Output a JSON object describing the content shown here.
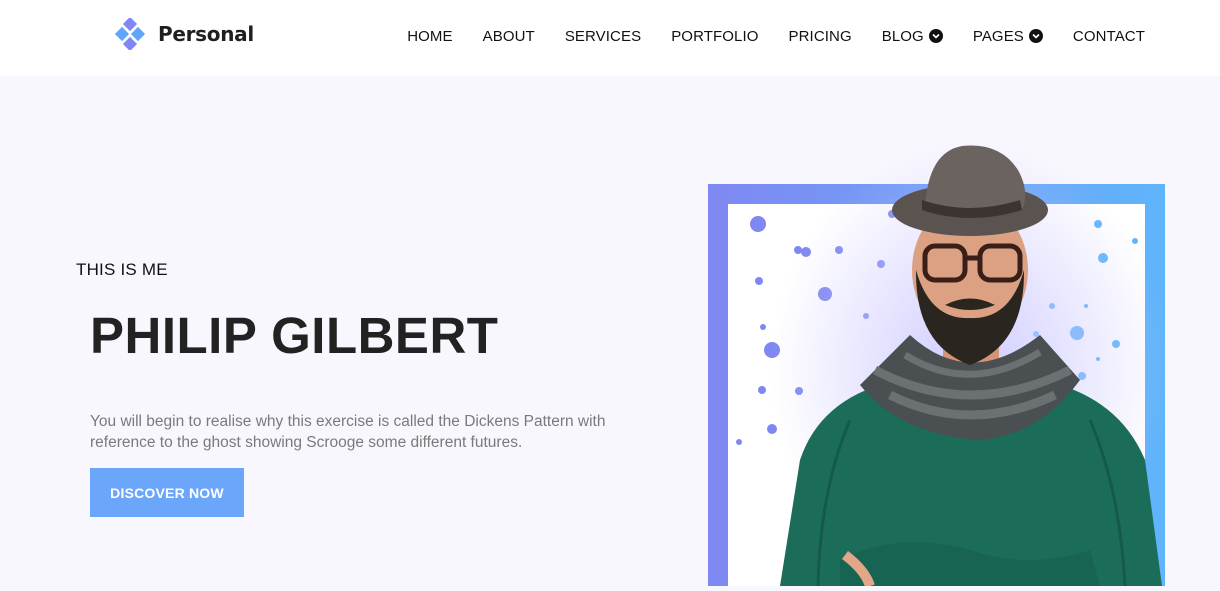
{
  "brand": {
    "name": "Personal",
    "logo_icon": "diamond-cluster-icon",
    "accent": "#6ba6fb"
  },
  "nav": {
    "items": [
      {
        "label": "HOME",
        "dropdown": false
      },
      {
        "label": "ABOUT",
        "dropdown": false
      },
      {
        "label": "SERVICES",
        "dropdown": false
      },
      {
        "label": "PORTFOLIO",
        "dropdown": false
      },
      {
        "label": "PRICING",
        "dropdown": false
      },
      {
        "label": "BLOG",
        "dropdown": true
      },
      {
        "label": "PAGES",
        "dropdown": true
      },
      {
        "label": "CONTACT",
        "dropdown": false
      }
    ]
  },
  "hero": {
    "subtitle": "THIS IS ME",
    "title": "PHILIP GILBERT",
    "description": "You will begin to realise why this exercise is called the Dickens Pattern with reference to the ghost showing Scrooge some different futures.",
    "cta_label": "DISCOVER NOW",
    "frame_gradient": [
      "#7f88f2",
      "#5fb5fb"
    ],
    "sweater_color": "#1b6d5a"
  }
}
